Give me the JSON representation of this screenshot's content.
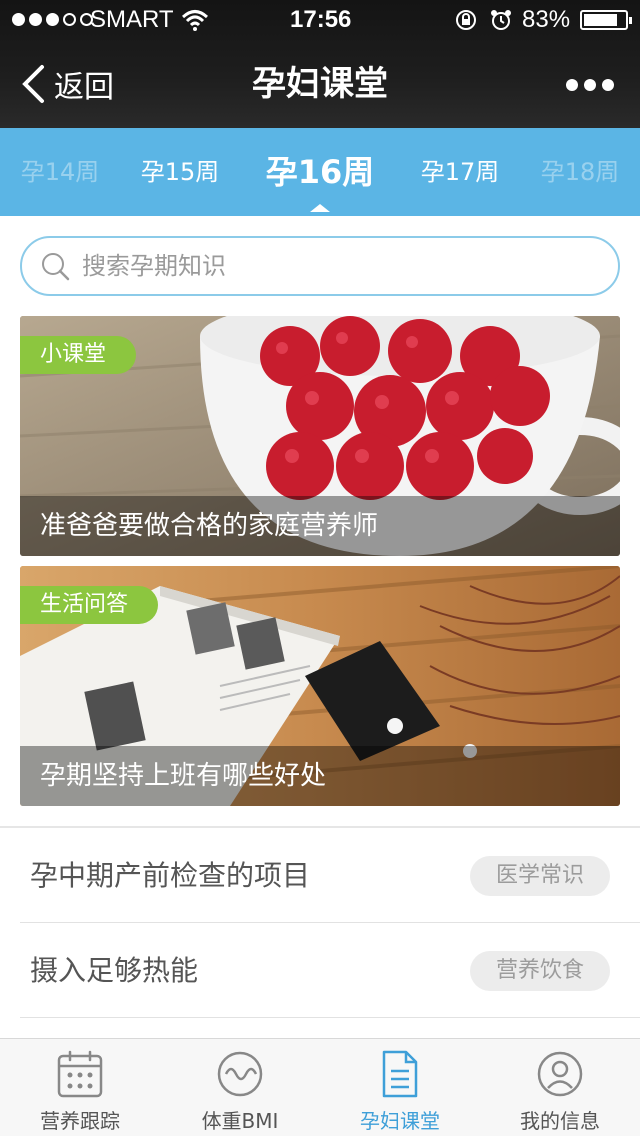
{
  "status_bar": {
    "carrier": "SMART",
    "time": "17:56",
    "battery_percent_text": "83%",
    "battery_level": 0.83,
    "signal_bars_filled": 3,
    "signal_bars_total": 5
  },
  "nav": {
    "back_label": "返回",
    "title": "孕妇课堂"
  },
  "weeks": {
    "items": [
      "孕14周",
      "孕15周",
      "孕16周",
      "孕17周",
      "孕18周"
    ],
    "selected": "孕16周"
  },
  "search": {
    "placeholder": "搜索孕期知识"
  },
  "cards": [
    {
      "tag": "小课堂",
      "caption": "准爸爸要做合格的家庭营养师"
    },
    {
      "tag": "生活问答",
      "caption": "孕期坚持上班有哪些好处"
    }
  ],
  "articles": [
    {
      "title": "孕中期产前检查的项目",
      "category": "医学常识"
    },
    {
      "title": "摄入足够热能",
      "category": "营养饮食"
    }
  ],
  "tabbar": {
    "items": [
      {
        "label": "营养跟踪",
        "icon": "calendar-icon"
      },
      {
        "label": "体重BMI",
        "icon": "wave-icon"
      },
      {
        "label": "孕妇课堂",
        "icon": "document-icon"
      },
      {
        "label": "我的信息",
        "icon": "user-icon"
      }
    ],
    "active": "孕妇课堂"
  },
  "colors": {
    "week_bar": "#5bb5e5",
    "tag_green": "#8cc63f",
    "active_tab": "#3e9fd8"
  }
}
